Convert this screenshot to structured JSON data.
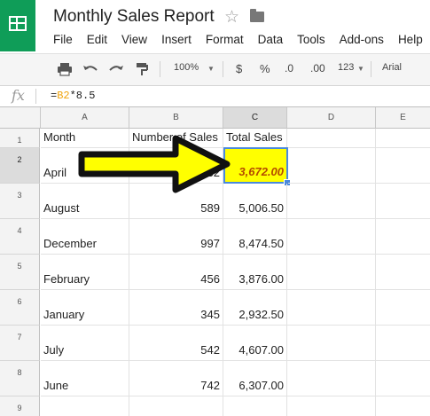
{
  "app": {
    "title": "Monthly Sales Report",
    "star_icon": "star-outline-icon",
    "folder_icon": "folder-icon"
  },
  "menu": [
    "File",
    "Edit",
    "View",
    "Insert",
    "Format",
    "Data",
    "Tools",
    "Add-ons",
    "Help"
  ],
  "toolbar": {
    "zoom": "100%",
    "currency": "$",
    "percent": "%",
    "decrease_decimals": ".0",
    "increase_decimals": ".00",
    "more_formats": "123",
    "font": "Arial"
  },
  "formula_bar": {
    "fx_label": "fx",
    "formula_prefix": "=",
    "formula_ref": "B2",
    "formula_rest": "*8.5"
  },
  "sheet": {
    "columns": [
      "A",
      "B",
      "C",
      "D",
      "E"
    ],
    "selected_column": "C",
    "selected_row": "2",
    "rows": [
      {
        "num": "1",
        "a": "Month",
        "b": "Number of Sales",
        "c": "Total Sales"
      },
      {
        "num": "2",
        "a": "April",
        "b": "432",
        "c": "3,672.00"
      },
      {
        "num": "3",
        "a": "August",
        "b": "589",
        "c": "5,006.50"
      },
      {
        "num": "4",
        "a": "December",
        "b": "997",
        "c": "8,474.50"
      },
      {
        "num": "5",
        "a": "February",
        "b": "456",
        "c": "3,876.00"
      },
      {
        "num": "6",
        "a": "January",
        "b": "345",
        "c": "2,932.50"
      },
      {
        "num": "7",
        "a": "July",
        "b": "542",
        "c": "4,607.00"
      },
      {
        "num": "8",
        "a": "June",
        "b": "742",
        "c": "6,307.00"
      },
      {
        "num": "9",
        "a": "",
        "b": "",
        "c": ""
      }
    ],
    "highlight_color": "#ffff00",
    "arrow_color": "#ffff00"
  }
}
